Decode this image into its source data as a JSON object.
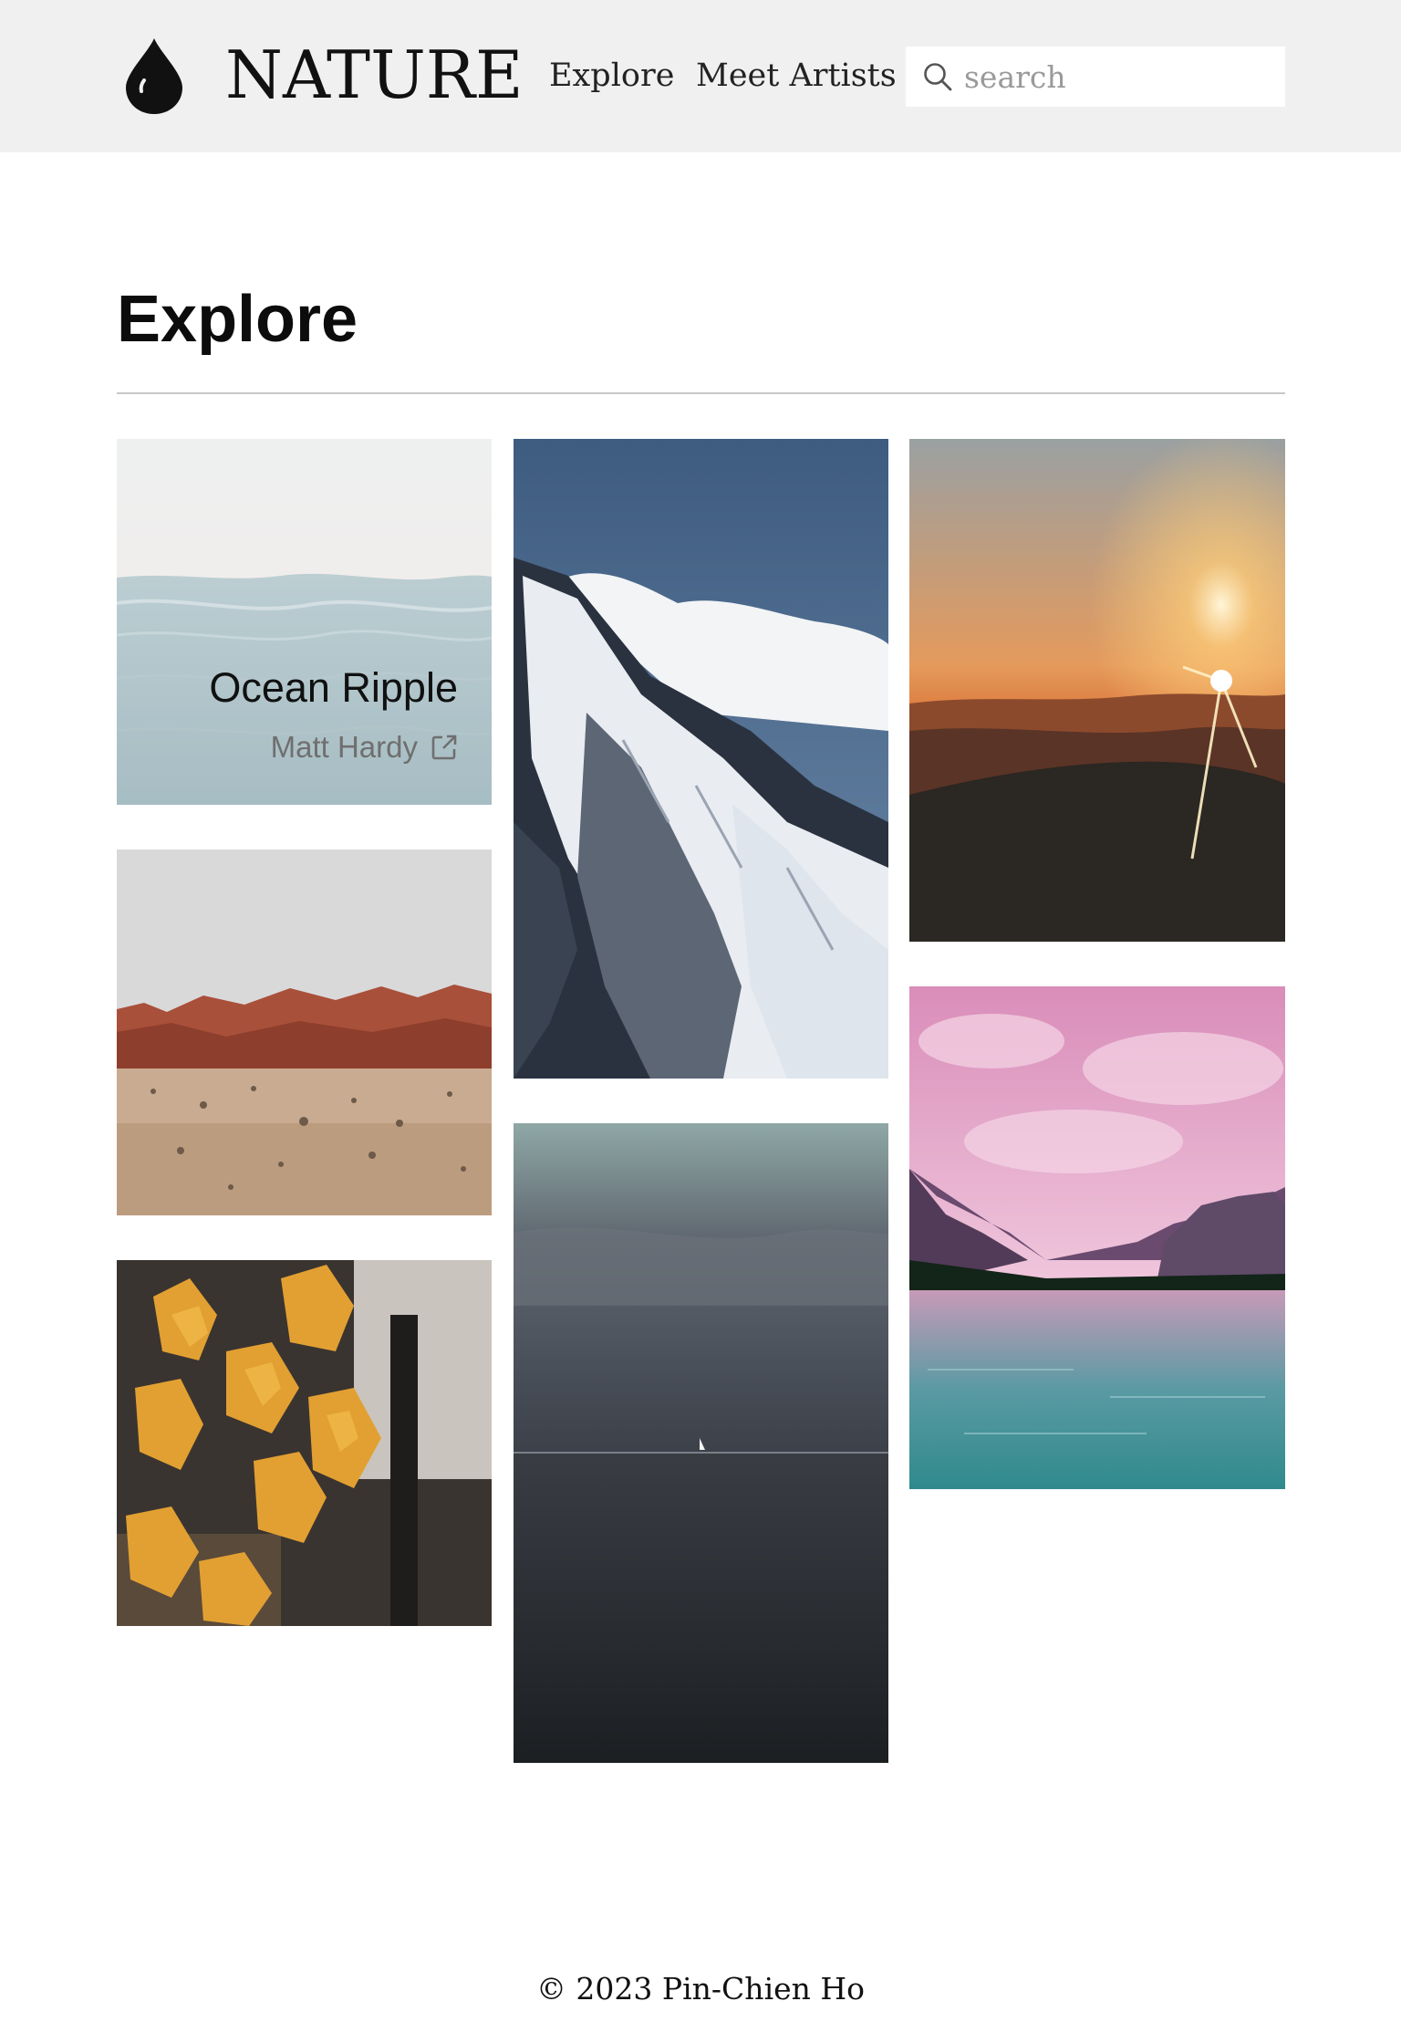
{
  "header": {
    "brand": "NATURE",
    "logo_icon": "water-drop-icon",
    "nav": [
      {
        "label": "Explore"
      },
      {
        "label": "Meet Artists"
      }
    ],
    "search": {
      "placeholder": "search",
      "value": "",
      "icon": "search-icon"
    }
  },
  "main": {
    "title": "Explore",
    "gallery": [
      {
        "subject": "ocean ripple",
        "title": "Ocean Ripple",
        "artist": "Matt Hardy",
        "link_icon": "external-link-icon"
      },
      {
        "subject": "red rock desert"
      },
      {
        "subject": "autumn maple leaves"
      },
      {
        "subject": "snowy mountain"
      },
      {
        "subject": "dark sea with sailboat"
      },
      {
        "subject": "mountain sunset"
      },
      {
        "subject": "pink sky mountain lake"
      }
    ]
  },
  "footer": {
    "copyright": "© 2023 Pin-Chien Ho"
  },
  "colors": {
    "header_bg": "#f0f0f0",
    "page_bg": "#ffffff",
    "text": "#111111",
    "artist_text": "#6f6f6f",
    "rule": "#c8c8c8"
  }
}
